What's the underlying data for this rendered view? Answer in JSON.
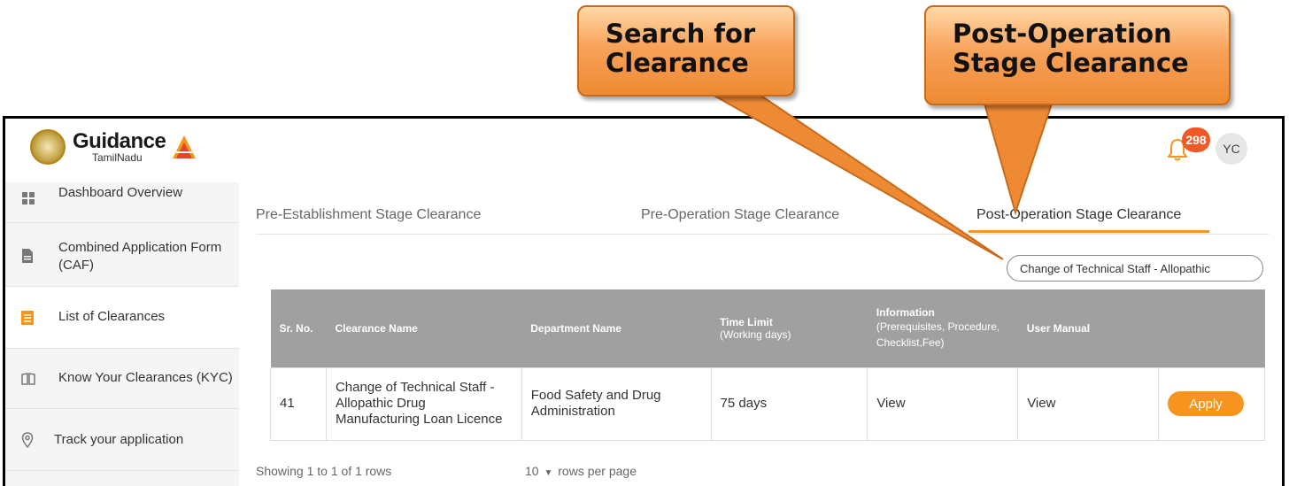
{
  "callouts": {
    "search": "Search for Clearance",
    "post": "Post-Operation Stage Clearance"
  },
  "header": {
    "logo_main": "Guidance",
    "logo_sub": "TamilNadu",
    "notification_count": "298",
    "avatar_initials": "YC"
  },
  "sidebar": {
    "items": [
      {
        "label": "Dashboard Overview",
        "icon": "grid-icon"
      },
      {
        "label": "Combined Application Form (CAF)",
        "icon": "document-icon"
      },
      {
        "label": "List of Clearances",
        "icon": "list-icon"
      },
      {
        "label": "Know Your Clearances (KYC)",
        "icon": "book-icon"
      },
      {
        "label": "Track your application",
        "icon": "location-pin-icon"
      }
    ]
  },
  "tabs": [
    {
      "label": "Pre-Establishment Stage Clearance"
    },
    {
      "label": "Pre-Operation Stage Clearance"
    },
    {
      "label": "Post-Operation Stage Clearance"
    }
  ],
  "search": {
    "value": "Change of Technical Staff - Allopathic"
  },
  "table": {
    "headers": {
      "sr_no": "Sr. No.",
      "clearance_name": "Clearance Name",
      "department_name": "Department Name",
      "time_limit": "Time Limit",
      "time_limit_sub": "(Working days)",
      "information": "Information",
      "information_sub": "(Prerequisites, Procedure, Checklist,Fee)",
      "user_manual": "User Manual"
    },
    "rows": [
      {
        "sr_no": "41",
        "clearance_name": "Change of Technical Staff - Allopathic Drug Manufacturing Loan Licence",
        "department_name": "Food Safety and Drug Administration",
        "time_limit": "75 days",
        "information": "View",
        "user_manual": "View",
        "action": "Apply"
      }
    ]
  },
  "footer": {
    "showing": "Showing 1 to 1 of 1 rows",
    "page_size": "10",
    "rows_per_page": "rows per page"
  },
  "colors": {
    "accent": "#f7941d",
    "badge": "#f05a28",
    "table_header": "#a0a0a0"
  }
}
